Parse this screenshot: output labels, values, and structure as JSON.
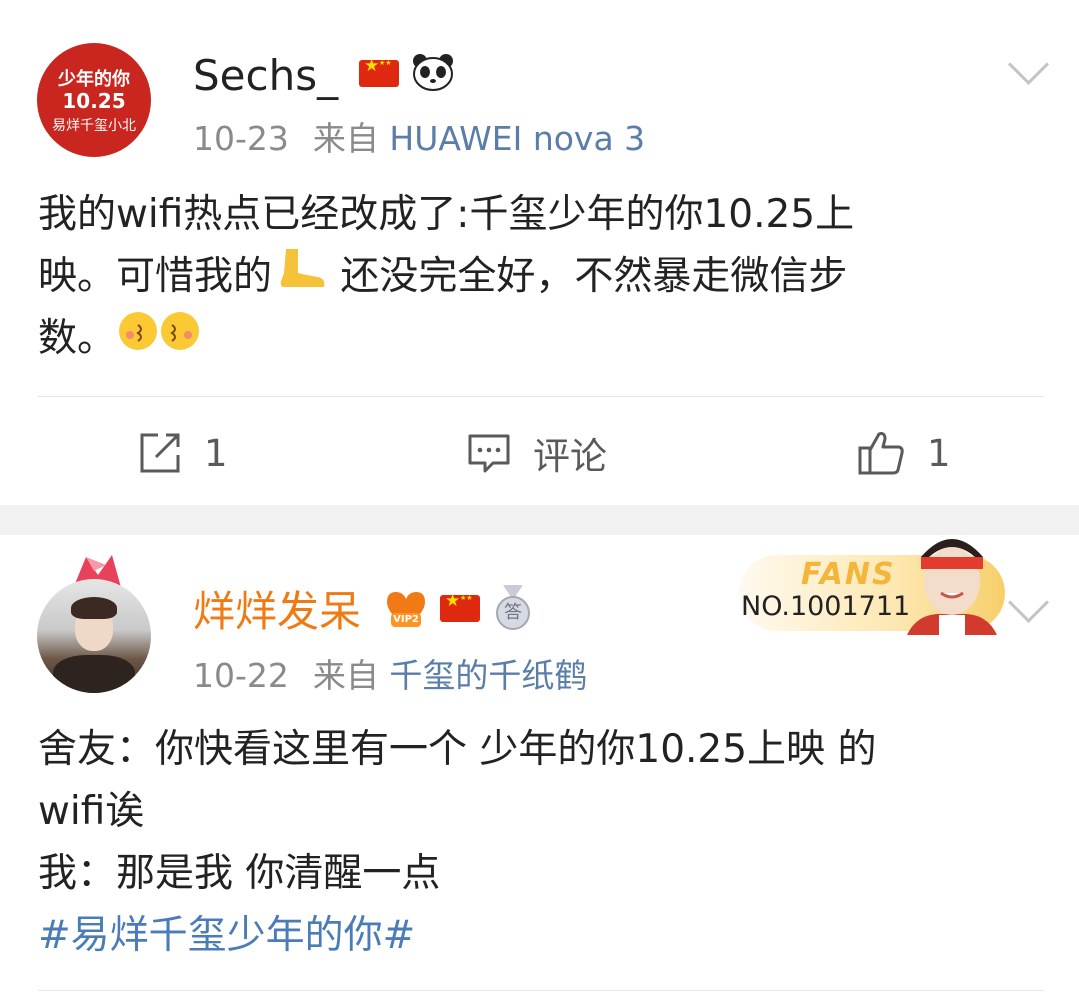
{
  "posts": [
    {
      "username": "Sechs_",
      "date": "10-23",
      "source_prefix": "来自",
      "source": "HUAWEI nova 3",
      "avatar_text": {
        "line1": "少年的你",
        "line2": "10.25",
        "line3": "易烊千玺小北"
      },
      "lines": [
        "我的wifi热点已经改成了:千玺少年的你10.25上",
        "映。可惜我的",
        " 还没完全好，不然暴走微信步",
        "数。"
      ],
      "actions": {
        "repost_count": "1",
        "comment_label": "评论",
        "like_count": "1"
      }
    },
    {
      "username": "烊烊发呆",
      "date": "10-22",
      "source_prefix": "来自",
      "source": "千玺的千纸鹤",
      "vip_label": "VIP2",
      "medal_label": "答",
      "fans_label": "FANS",
      "fans_number": "NO.1001711",
      "lines": [
        "舍友：你快看这里有一个 少年的你10.25上映 的",
        "wifi诶",
        "我：那是我 你清醒一点"
      ],
      "topic": "#易烊千玺少年的你#"
    }
  ],
  "colors": {
    "username_orange": "#f07a12",
    "link_blue": "#5b7ea8",
    "topic_blue": "#4a7cb8",
    "meta_gray": "#8a8a8a",
    "avatar_red": "#c8261e"
  },
  "icons": [
    "chevron-down-icon",
    "china-flag-icon",
    "panda-icon",
    "foot-emoji",
    "cheeky-face-emoji",
    "repost-icon",
    "comment-icon",
    "like-icon",
    "vip-heart-icon",
    "medal-icon",
    "fans-badge"
  ]
}
